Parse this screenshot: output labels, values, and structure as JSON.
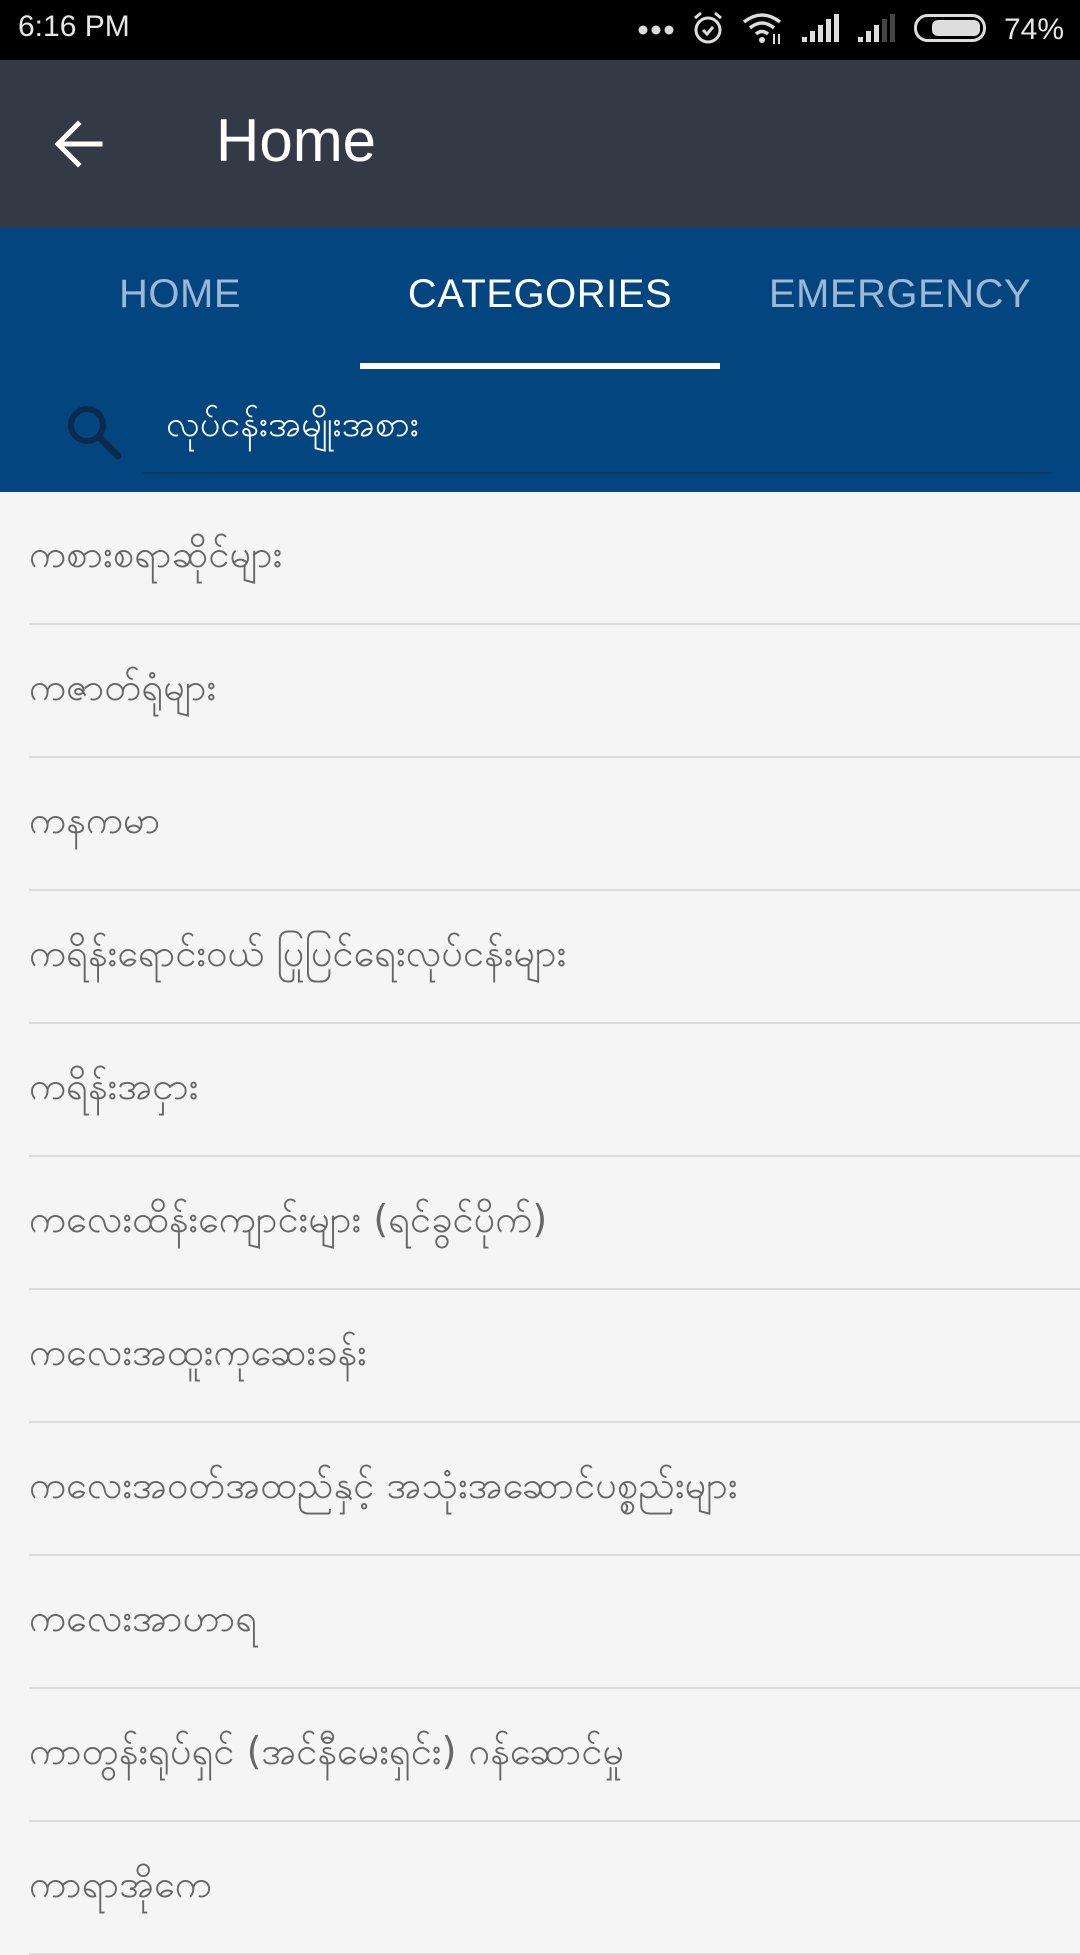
{
  "status_bar": {
    "time": "6:16 PM",
    "icons": [
      "more-dots-icon",
      "alarm-icon",
      "wifi-icon",
      "signal-icon",
      "signal-weak-icon",
      "battery-icon"
    ],
    "battery_percent": "74%",
    "battery_level": 0.74
  },
  "toolbar": {
    "back_icon": "arrow-left-icon",
    "title": "Home"
  },
  "tabs": [
    {
      "label": "HOME",
      "active": false
    },
    {
      "label": "CATEGORIES",
      "active": true
    },
    {
      "label": "EMERGENCY",
      "active": false
    }
  ],
  "search": {
    "icon": "search-icon",
    "value": "လုပ်ငန်းအမျိုးအစား"
  },
  "categories": [
    {
      "label": "ကစားစရာဆိုင်များ"
    },
    {
      "label": "ကဇာတ်ရုံများ"
    },
    {
      "label": "ကနကမာ"
    },
    {
      "label": "ကရိန်းရောင်းဝယ် ပြုပြင်ရေးလုပ်ငန်းများ"
    },
    {
      "label": "ကရိန်းအငှား"
    },
    {
      "label": "ကလေးထိန်းကျောင်းများ (ရင်ခွင်ပိုက်)"
    },
    {
      "label": "ကလေးအထူးကုဆေးခန်း"
    },
    {
      "label": "ကလေးအဝတ်အထည်နှင့် အသုံးအဆောင်ပစ္စည်းများ"
    },
    {
      "label": "ကလေးအာဟာရ"
    },
    {
      "label": "ကာတွန်းရုပ်ရှင် (အင်နီမေးရှင်း) ဂန်ဆောင်မှု"
    },
    {
      "label": "ကာရာအိုကေ"
    }
  ],
  "colors": {
    "toolbar_bg": "#343a45",
    "tab_bg": "#03467f",
    "tab_inactive": "#9db7d6",
    "list_bg": "#f5f5f5",
    "list_text": "#666666"
  }
}
